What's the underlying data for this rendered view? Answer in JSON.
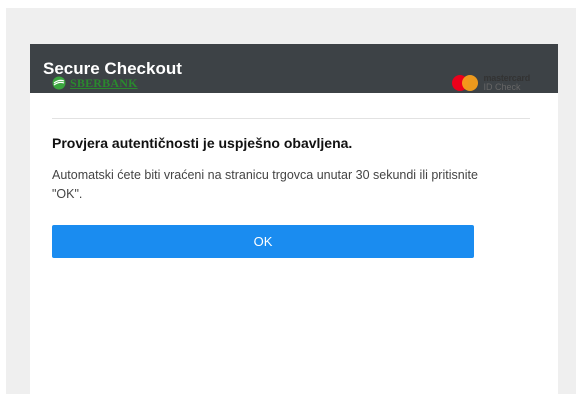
{
  "header": {
    "title": "Secure Checkout"
  },
  "bank": {
    "name": "SBERBANK",
    "logo_icon": "sberbank-logo-icon",
    "brand_color": "#2a8a2e"
  },
  "card_scheme": {
    "brand": "mastercard",
    "program": "ID Check",
    "logo_icon": "mastercard-logo-icon"
  },
  "content": {
    "heading": "Provjera autentičnosti je uspješno obavljena.",
    "message": "Automatski ćete biti vraćeni na stranicu trgovca unutar 30 sekundi ili pritisnite \"OK\"."
  },
  "actions": {
    "ok_label": "OK"
  },
  "colors": {
    "header_bg": "#3d4246",
    "button_bg": "#1a8cf0",
    "backdrop": "#efefef"
  }
}
